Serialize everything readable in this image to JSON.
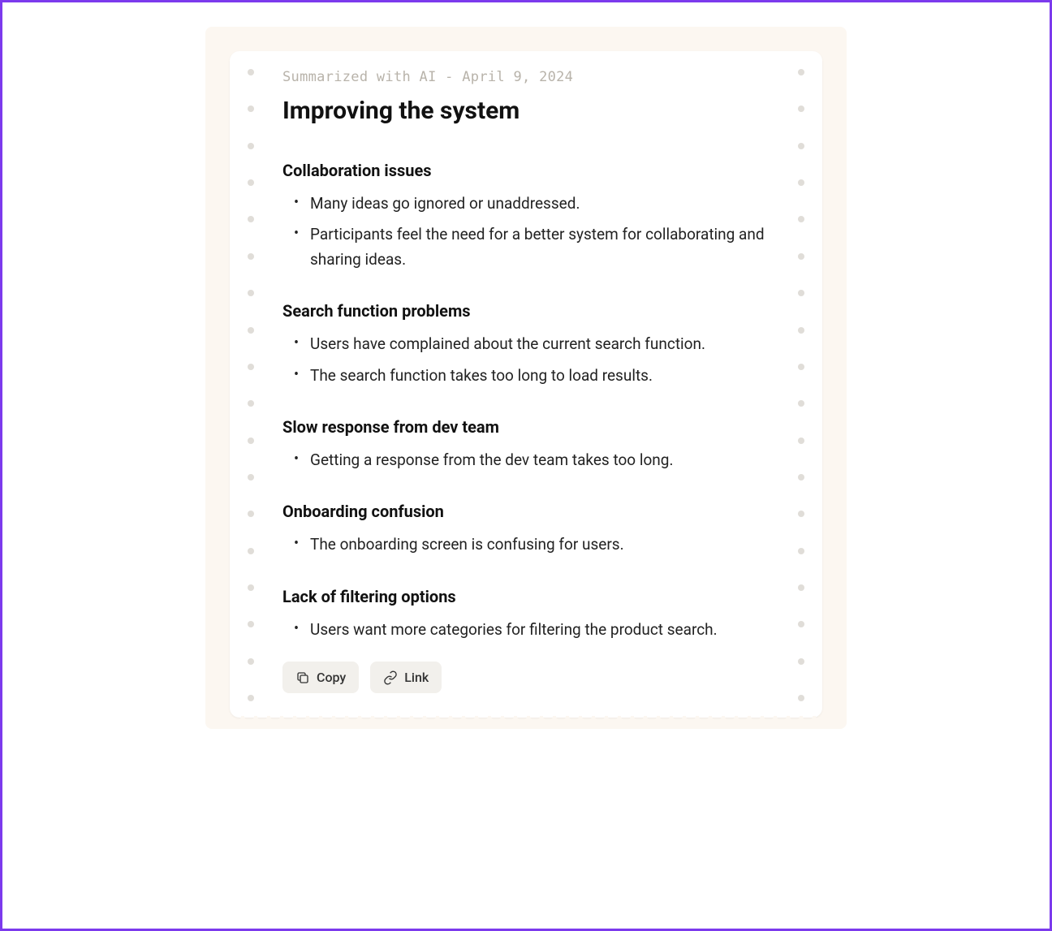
{
  "meta": {
    "prefix": "Summarized with AI",
    "separator": " - ",
    "date": "April 9, 2024"
  },
  "title": "Improving the system",
  "sections": [
    {
      "heading": "Collaboration issues",
      "items": [
        "Many ideas go ignored or unaddressed.",
        "Participants feel the need for a better system for collaborating and sharing ideas."
      ]
    },
    {
      "heading": "Search function problems",
      "items": [
        "Users have complained about the current search function.",
        "The search function takes too long to load results."
      ]
    },
    {
      "heading": "Slow response from dev team",
      "items": [
        "Getting a response from the dev team takes too long."
      ]
    },
    {
      "heading": "Onboarding confusion",
      "items": [
        "The onboarding screen is confusing for users."
      ]
    },
    {
      "heading": "Lack of filtering options",
      "items": [
        "Users want more categories for filtering the product search."
      ]
    }
  ],
  "actions": {
    "copy_label": "Copy",
    "link_label": "Link"
  }
}
